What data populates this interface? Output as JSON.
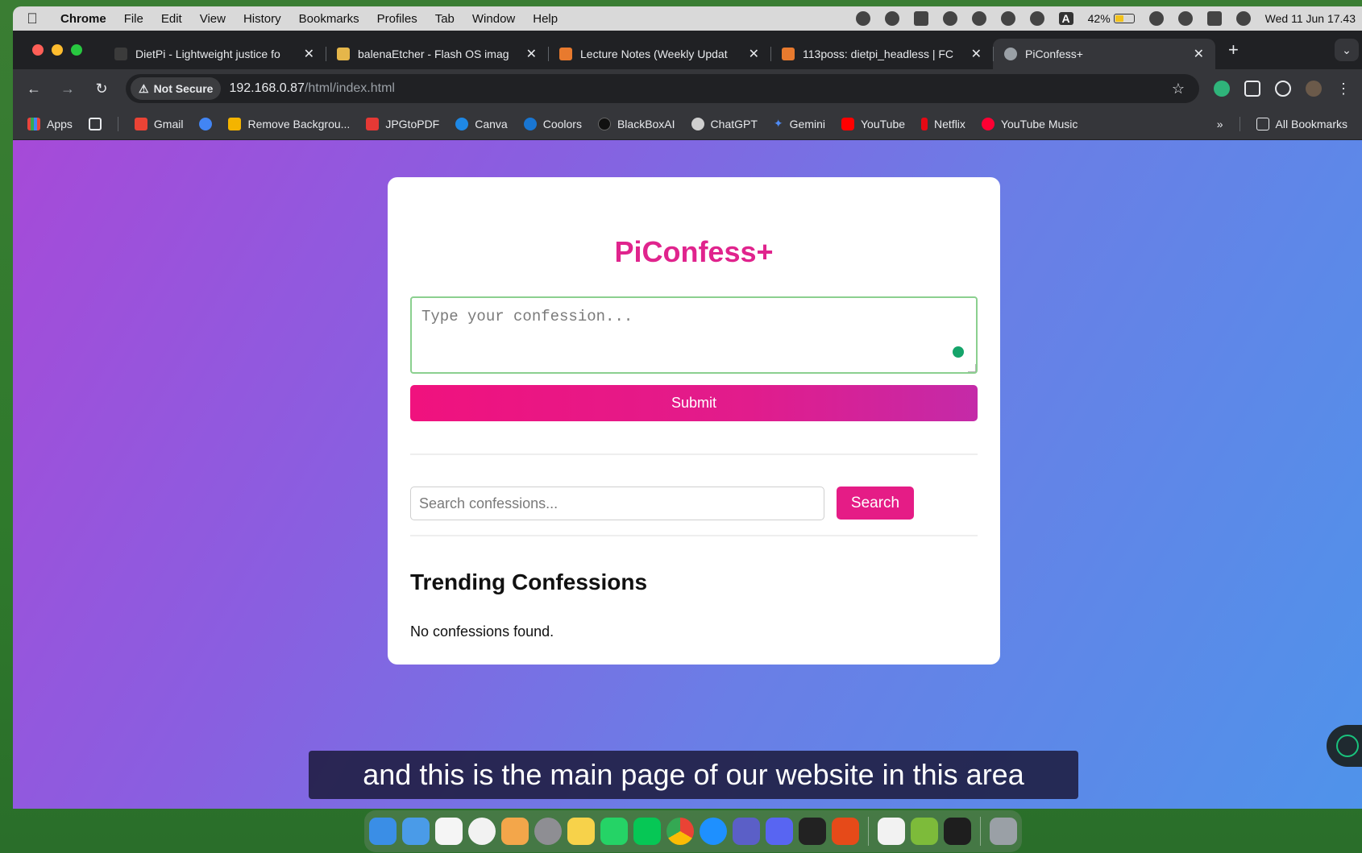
{
  "menubar": {
    "app": "Chrome",
    "items": [
      "File",
      "Edit",
      "View",
      "History",
      "Bookmarks",
      "Profiles",
      "Tab",
      "Window",
      "Help"
    ],
    "battery": "42%",
    "input_indicator": "A",
    "datetime": "Wed 11 Jun  17.43"
  },
  "tabs": [
    {
      "title": "DietPi - Lightweight justice fo",
      "favicon_color": "#3b3b3b",
      "active": false
    },
    {
      "title": "balenaEtcher - Flash OS imag",
      "favicon_color": "#e5b64a",
      "active": false
    },
    {
      "title": "Lecture Notes (Weekly Updat",
      "favicon_color": "#e87a2e",
      "active": false
    },
    {
      "title": "113poss: dietpi_headless | FC",
      "favicon_color": "#e87a2e",
      "active": false
    },
    {
      "title": "PiConfess+",
      "favicon_color": "#9aa0a6",
      "active": true
    }
  ],
  "toolbar": {
    "security_label": "Not Secure",
    "url_host": "192.168.0.87",
    "url_path": "/html/index.html"
  },
  "bookmarks": [
    {
      "label": "Apps",
      "color": "#e8453c"
    },
    {
      "label": "Gmail",
      "color": "#ea4335"
    },
    {
      "label": "",
      "color": "#4285f4"
    },
    {
      "label": "Remove Backgrou...",
      "color": "#f4b400"
    },
    {
      "label": "JPGtoPDF",
      "color": "#e53935"
    },
    {
      "label": "Canva",
      "color": "#1e88e5"
    },
    {
      "label": "Coolors",
      "color": "#1976d2"
    },
    {
      "label": "BlackBoxAI",
      "color": "#111111"
    },
    {
      "label": "ChatGPT",
      "color": "#cfcfcf"
    },
    {
      "label": "Gemini",
      "color": "#4f8bf5"
    },
    {
      "label": "YouTube",
      "color": "#ff0000"
    },
    {
      "label": "Netflix",
      "color": "#e50914"
    },
    {
      "label": "YouTube Music",
      "color": "#ff0033"
    }
  ],
  "bookmarks_more": "»",
  "all_bookmarks": "All Bookmarks",
  "app": {
    "title": "PiConfess+",
    "confession_placeholder": "Type your confession...",
    "submit_label": "Submit",
    "search_placeholder": "Search confessions...",
    "search_label": "Search",
    "trending_title": "Trending Confessions",
    "empty_message": "No confessions found."
  },
  "caption": "and this is the main page of our website in this area",
  "dock": {
    "apps": [
      {
        "name": "finder",
        "color": "#3a8ee6"
      },
      {
        "name": "mail",
        "color": "#4a9be8"
      },
      {
        "name": "calendar",
        "color": "#f5f5f5"
      },
      {
        "name": "clock",
        "color": "#f2f2f2"
      },
      {
        "name": "photos",
        "color": "#f3a64a"
      },
      {
        "name": "settings",
        "color": "#8e8e93"
      },
      {
        "name": "notes",
        "color": "#f7d24a"
      },
      {
        "name": "whatsapp",
        "color": "#25d366"
      },
      {
        "name": "line",
        "color": "#06c755"
      },
      {
        "name": "chrome",
        "color": "#ea4335"
      },
      {
        "name": "safari",
        "color": "#1e90ff"
      },
      {
        "name": "teams",
        "color": "#5b5fc7"
      },
      {
        "name": "discord",
        "color": "#5865f2"
      },
      {
        "name": "unity",
        "color": "#222222"
      },
      {
        "name": "office",
        "color": "#e64a19"
      },
      {
        "name": "textedit",
        "color": "#f2f2f2"
      },
      {
        "name": "app-cube",
        "color": "#7dbb3a"
      },
      {
        "name": "terminal",
        "color": "#1e1e1e"
      },
      {
        "name": "trash",
        "color": "#9aa0a6"
      }
    ]
  }
}
